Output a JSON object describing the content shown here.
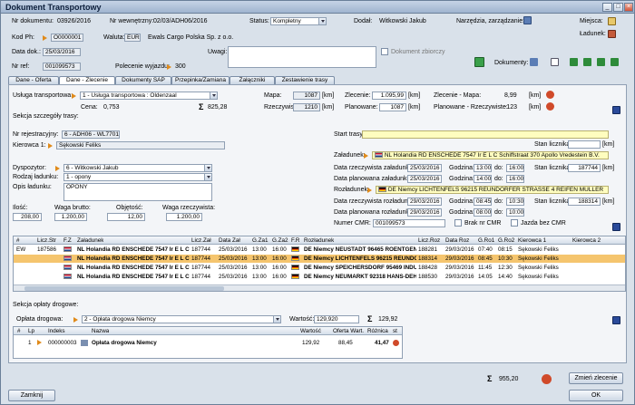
{
  "window": {
    "title": "Dokument Transportowy"
  },
  "header": {
    "nr_dokumentu_label": "Nr dokumentu:",
    "nr_dokumentu": "03926/2016",
    "nr_wewn_label": "Nr wewnętrzny:",
    "nr_wewn": "02/03/ADH06/2016",
    "status_label": "Status:",
    "status": "Kompletny",
    "dodal_label": "Dodał:",
    "dodal": "Witkowski Jakub",
    "narzedzia_label": "Narzędzia, zarządzanie:",
    "miejsca_label": "Miejsca:",
    "ladunek_label": "Ładunek:",
    "kod_ph_label": "Kod Ph:",
    "kod_ph": "O0000001",
    "waluta_label": "Waluta:",
    "waluta": "EUR",
    "firma": "Ewals Cargo Polska Sp. z o.o.",
    "data_dok_label": "Data dok.:",
    "data_dok": "25/03/2016",
    "uwagi_label": "Uwagi:",
    "dok_zbiorczy_label": "Dokument zbiorczy",
    "nr_ref_label": "Nr ref:",
    "nr_ref": "001099573",
    "polecenie_label": "Polecenie wyjazdu:",
    "polecenie": "300",
    "dokumenty_label": "Dokumenty:"
  },
  "tabs": [
    "Dane - Oferta",
    "Dane - Zlecenie",
    "Dokumenty SAP",
    "Przepinka/Zamiana",
    "Załączniki",
    "Zestawienie trasy"
  ],
  "service": {
    "usluga_label": "Usługa transportowa:",
    "usluga": "1 - Usługa transportowa : Oldenzaal",
    "cena_label": "Cena:",
    "cena": "0,753",
    "suma": "825,28",
    "mapa_label": "Mapa:",
    "mapa": "1087",
    "km": "[km]",
    "rzecz_label": "Rzeczywiste:",
    "rzecz": "1210",
    "zlecenie_label": "Zlecenie:",
    "zlecenie": "1.095,99",
    "planowane_label": "Planowane:",
    "planowane": "1087",
    "zlec_mapa_label": "Zlecenie - Mapa:",
    "zlec_mapa": "8,99",
    "plan_rzecz_label": "Planowane - Rzeczywiste:",
    "plan_rzecz": "-123"
  },
  "sekcja_trasy": "Sekcja szczegóły trasy:",
  "route": {
    "nr_rej_label": "Nr rejestracyjny:",
    "nr_rej": "6 - ADH06 - WL7701F",
    "kierowca_label": "Kierowca 1:",
    "kierowca": "Sękowski Feliks",
    "dyspozytor_label": "Dyspozytor:",
    "dyspozytor": "6 - Witkowski Jakub",
    "rodzaj_label": "Rodzaj ładunku:",
    "rodzaj": "1 - opony",
    "opis_label": "Opis ładunku:",
    "opis": "OPONY",
    "ilosc_label": "Ilość:",
    "ilosc": "208,00",
    "waga_b_label": "Waga brutto:",
    "waga_b": "1.200,00",
    "objetosc_label": "Objętość:",
    "objetosc": "12,00",
    "waga_r_label": "Waga rzeczywista:",
    "waga_r": "1.200,00",
    "start_label": "Start trasy:",
    "stan_licznika_label": "Stan licznika:",
    "zaladunek_label": "Załadunek:",
    "zaladunek": "NL Holandia RD ENSCHEDE 7547 Ir E L C Schiffstraat 370 Apollo Vredestein B.V.",
    "data_rz_zal_label": "Data rzeczywista załadunku:",
    "data_rz_zal": "25/03/2016",
    "godzina_label": "Godzina:",
    "g_rz_zal_od": "13:00",
    "do_label": "do:",
    "g_rz_zal_do": "16:00",
    "stan_zal": "187744",
    "data_pl_zal_label": "Data planowana załadunku:",
    "data_pl_zal": "25/03/2016",
    "g_pl_zal_od": "14:00",
    "g_pl_zal_do": "16:00",
    "rozladunek_label": "Rozładunek:",
    "rozladunek": "DE Niemcy LICHTENFELS 96215 REUNDORFER STRASSE 4 REIFEN MULLER",
    "data_rz_roz_label": "Data rzeczywista rozładunku:",
    "data_rz_roz": "29/03/2016",
    "g_rz_roz_od": "08:45",
    "g_rz_roz_do": "10:30",
    "stan_roz": "188314",
    "data_pl_roz_label": "Data planowana rozładunku:",
    "data_pl_roz": "29/03/2016",
    "g_pl_roz_od": "08:00",
    "g_pl_roz_do": "10:00",
    "nr_cmr_label": "Numer CMR:",
    "nr_cmr": "001099573",
    "brak_cmr_label": "Brak nr CMR",
    "jazda_bez_label": "Jazda bez CMR"
  },
  "grid": {
    "headers": [
      "#",
      "Licz.Str",
      "F.Z",
      "Załadunek",
      "Licz.Zał",
      "Data Zał",
      "G.Za1",
      "G.Za2",
      "F.R",
      "Rozładunek",
      "Licz.Roz",
      "Data Roz",
      "G.Ro1",
      "G.Ro2",
      "Kierowca 1",
      "Kierowca 2"
    ],
    "rows": [
      {
        "hash": "EW",
        "licz_str": "187586",
        "zal": "NL Holandia RD ENSCHEDE 7547 Ir E L C S",
        "licz_zal": "187744",
        "data_zal": "25/03/2016",
        "g1": "13:00",
        "g2": "16:00",
        "roz": "DE Niemcy NEUSTADT 96465 ROENTGENST",
        "licz_roz": "188281",
        "data_roz": "29/03/2016",
        "r1": "07:40",
        "r2": "08:15",
        "k1": "Sękowski Feliks",
        "k2": ""
      },
      {
        "hash": "",
        "licz_str": "",
        "zal": "NL Holandia RD ENSCHEDE 7547 Ir E L C S",
        "licz_zal": "187744",
        "data_zal": "25/03/2016",
        "g1": "13:00",
        "g2": "16:00",
        "roz": "DE Niemcy LICHTENFELS 96215 REUNDORF",
        "licz_roz": "188314",
        "data_roz": "29/03/2016",
        "r1": "08:45",
        "r2": "10:30",
        "k1": "Sękowski Feliks",
        "k2": ""
      },
      {
        "hash": "",
        "licz_str": "",
        "zal": "NL Holandia RD ENSCHEDE 7547 Ir E L C S",
        "licz_zal": "187744",
        "data_zal": "25/03/2016",
        "g1": "13:00",
        "g2": "16:00",
        "roz": "DE Niemcy SPEICHERSDORF 95469 INDUST",
        "licz_roz": "188428",
        "data_roz": "29/03/2016",
        "r1": "11:45",
        "r2": "12:30",
        "k1": "Sękowski Feliks",
        "k2": ""
      },
      {
        "hash": "",
        "licz_str": "",
        "zal": "NL Holandia RD ENSCHEDE 7547 Ir E L C S",
        "licz_zal": "187744",
        "data_zal": "25/03/2016",
        "g1": "13:00",
        "g2": "16:00",
        "roz": "DE Niemcy NEUMARKT 92318 HANS-DEHN-",
        "licz_roz": "188530",
        "data_roz": "29/03/2016",
        "r1": "14:05",
        "r2": "14:40",
        "k1": "Sękowski Feliks",
        "k2": ""
      }
    ]
  },
  "oplaty": {
    "sekcja": "Sekcja opłaty drogowe:",
    "label": "Opłata drogowa:",
    "value": "2 - Opłata drogowa Niemcy",
    "wartosc_label": "Wartość:",
    "wartosc": "129,920",
    "suma": "129,92",
    "headers": [
      "#",
      "Lp",
      "Indeks",
      "Nazwa",
      "Wartość",
      "Oferta Wart.",
      "Różnica",
      "st"
    ],
    "rows": [
      {
        "lp": "1",
        "indeks": "000000003",
        "nazwa": "Opłata drogowa Niemcy",
        "wartosc": "129,92",
        "oferta": "88,45",
        "roznica": "41,47"
      }
    ]
  },
  "footer": {
    "suma": "955,20",
    "zmien": "Zmień zlecenie",
    "zamknij": "Zamknij",
    "ok": "OK"
  }
}
